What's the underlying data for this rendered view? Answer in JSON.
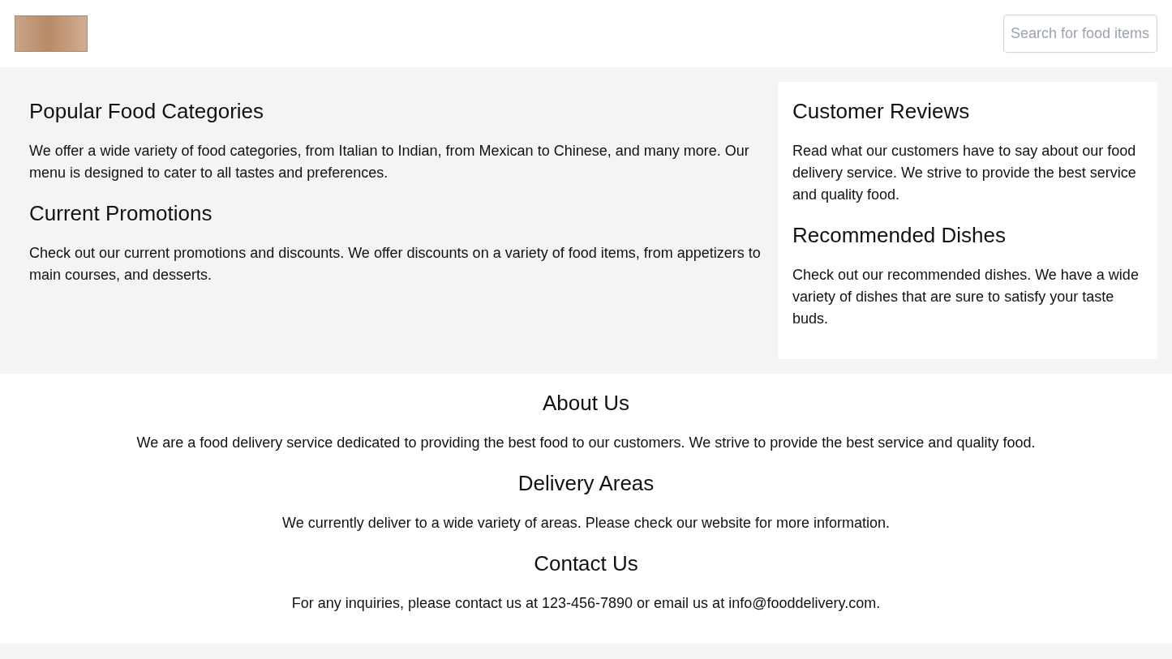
{
  "header": {
    "search": {
      "placeholder": "Search for food items"
    }
  },
  "main": {
    "sections": [
      {
        "heading": "Popular Food Categories",
        "text": "We offer a wide variety of food categories, from Italian to Indian, from Mexican to Chinese, and many more. Our menu is designed to cater to all tastes and preferences."
      },
      {
        "heading": "Current Promotions",
        "text": "Check out our current promotions and discounts. We offer discounts on a variety of food items, from appetizers to main courses, and desserts."
      }
    ]
  },
  "sidebar": {
    "sections": [
      {
        "heading": "Customer Reviews",
        "text": "Read what our customers have to say about our food delivery service. We strive to provide the best service and quality food."
      },
      {
        "heading": "Recommended Dishes",
        "text": "Check out our recommended dishes. We have a wide variety of dishes that are sure to satisfy your taste buds."
      }
    ]
  },
  "footer": {
    "sections": [
      {
        "heading": "About Us",
        "text": "We are a food delivery service dedicated to providing the best food to our customers. We strive to provide the best service and quality food."
      },
      {
        "heading": "Delivery Areas",
        "text": "We currently deliver to a wide variety of areas. Please check our website for more information."
      },
      {
        "heading": "Contact Us",
        "text": "For any inquiries, please contact us at 123-456-7890 or email us at info@fooddelivery.com."
      }
    ]
  }
}
